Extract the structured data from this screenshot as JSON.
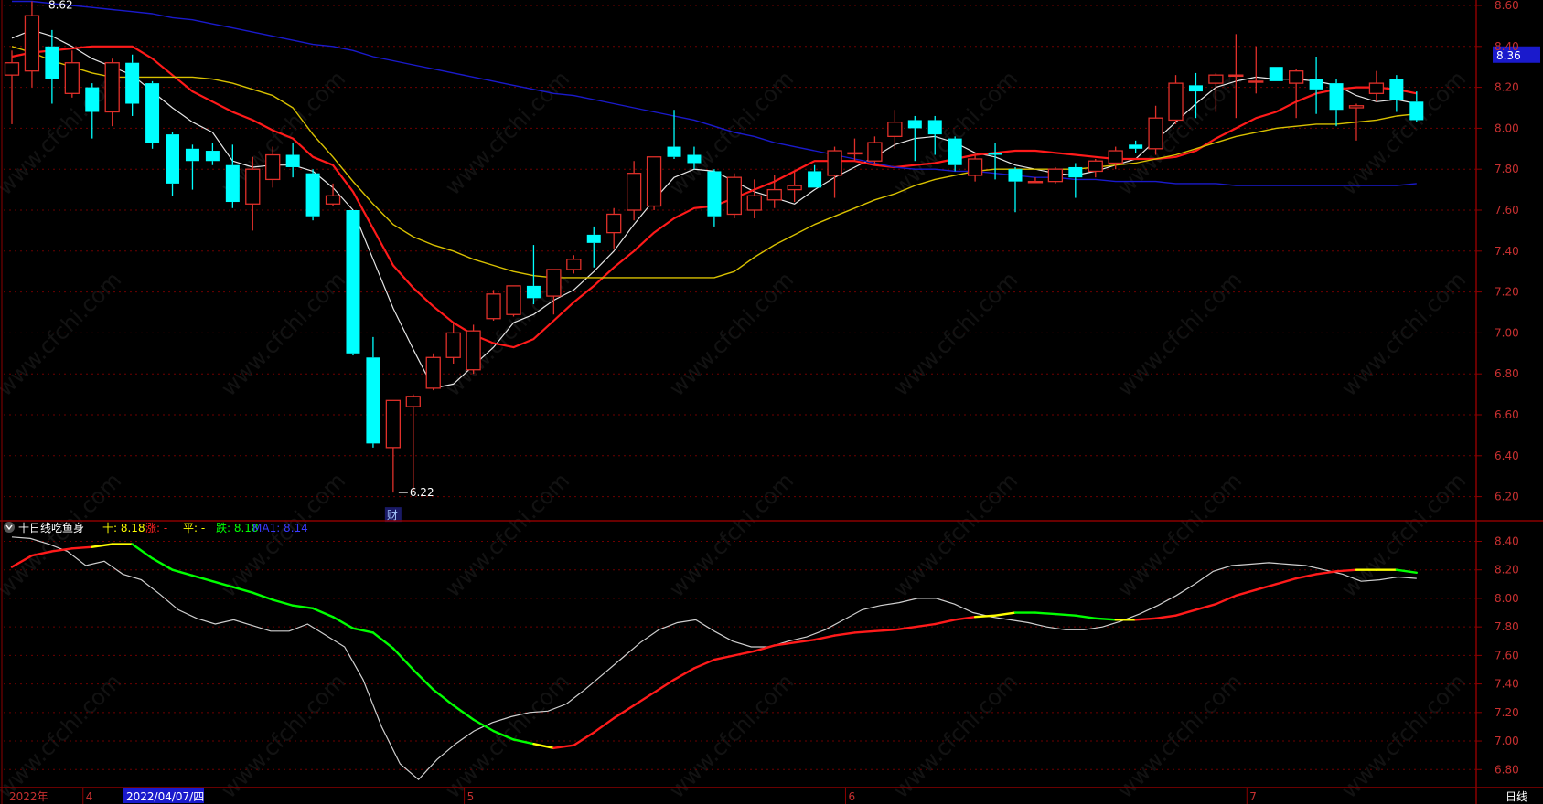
{
  "colors": {
    "background": "#000000",
    "axis": "#8b0000",
    "grid": "#6e0000",
    "up_candle": "#e0302a",
    "down_candle": "#00ffff",
    "ma_white": "#e6e6e6",
    "ma_red": "#ff1a1a",
    "ma_yellow": "#d8c000",
    "ma_blue": "#1a1acc",
    "indicator_up": "#ff1a1a",
    "indicator_flat": "#ffff00",
    "indicator_down": "#00ff00",
    "indicator_ma": "#cfcfcf",
    "tick_label": "#c83030",
    "current_price_bg": "#1a1acc"
  },
  "watermark": "www.cfchi.com",
  "annotations": {
    "high_label": "8.62",
    "low_label": "6.22",
    "finance_marker": "财",
    "current_price_tag": "8.36"
  },
  "indicator_legend": {
    "icon": "chevron-down-icon",
    "name": "十日线吃鱼身",
    "shi_label": "十: 8.18",
    "zhang_label": "涨: -",
    "ping_label": "平: -",
    "die_label": "跌: 8.18",
    "ma1_label": "MA1: 8.14"
  },
  "bottom_bar": {
    "year_label": "2022年",
    "month_labels": [
      {
        "text": "4",
        "idx": 4
      },
      {
        "text": "5",
        "idx": 23
      },
      {
        "text": "6",
        "idx": 42
      },
      {
        "text": "7",
        "idx": 62
      }
    ],
    "cursor_date": "2022/04/07/四",
    "period_label": "日线"
  },
  "chart_data": [
    {
      "type": "candlestick",
      "title": "",
      "ylim": [
        6.1,
        8.6
      ],
      "y_ticks": [
        6.2,
        6.4,
        6.6,
        6.8,
        7.0,
        7.2,
        7.4,
        7.6,
        7.8,
        8.0,
        8.2,
        8.4,
        8.6
      ],
      "grid": true,
      "candles": [
        {
          "o": 8.26,
          "h": 8.38,
          "l": 8.02,
          "c": 8.32
        },
        {
          "o": 8.28,
          "h": 8.62,
          "l": 8.2,
          "c": 8.55
        },
        {
          "o": 8.4,
          "h": 8.48,
          "l": 8.12,
          "c": 8.24
        },
        {
          "o": 8.17,
          "h": 8.38,
          "l": 8.15,
          "c": 8.32
        },
        {
          "o": 8.2,
          "h": 8.22,
          "l": 7.95,
          "c": 8.08
        },
        {
          "o": 8.08,
          "h": 8.34,
          "l": 8.01,
          "c": 8.32
        },
        {
          "o": 8.32,
          "h": 8.36,
          "l": 8.06,
          "c": 8.12
        },
        {
          "o": 8.22,
          "h": 8.23,
          "l": 7.9,
          "c": 7.93
        },
        {
          "o": 7.97,
          "h": 7.98,
          "l": 7.67,
          "c": 7.73
        },
        {
          "o": 7.9,
          "h": 7.92,
          "l": 7.7,
          "c": 7.84
        },
        {
          "o": 7.89,
          "h": 7.93,
          "l": 7.82,
          "c": 7.84
        },
        {
          "o": 7.82,
          "h": 7.92,
          "l": 7.61,
          "c": 7.64
        },
        {
          "o": 7.63,
          "h": 7.86,
          "l": 7.5,
          "c": 7.8
        },
        {
          "o": 7.75,
          "h": 7.91,
          "l": 7.71,
          "c": 7.87
        },
        {
          "o": 7.87,
          "h": 7.93,
          "l": 7.76,
          "c": 7.81
        },
        {
          "o": 7.78,
          "h": 7.8,
          "l": 7.55,
          "c": 7.57
        },
        {
          "o": 7.63,
          "h": 7.73,
          "l": 7.62,
          "c": 7.67
        },
        {
          "o": 7.6,
          "h": 7.6,
          "l": 6.89,
          "c": 6.9
        },
        {
          "o": 6.88,
          "h": 6.98,
          "l": 6.44,
          "c": 6.46
        },
        {
          "o": 6.44,
          "h": 6.67,
          "l": 6.22,
          "c": 6.67
        },
        {
          "o": 6.64,
          "h": 6.7,
          "l": 6.22,
          "c": 6.69
        },
        {
          "o": 6.73,
          "h": 6.9,
          "l": 6.72,
          "c": 6.88
        },
        {
          "o": 6.88,
          "h": 7.05,
          "l": 6.85,
          "c": 7.0
        },
        {
          "o": 6.82,
          "h": 7.04,
          "l": 6.8,
          "c": 7.01
        },
        {
          "o": 7.07,
          "h": 7.21,
          "l": 7.06,
          "c": 7.19
        },
        {
          "o": 7.09,
          "h": 7.23,
          "l": 7.08,
          "c": 7.23
        },
        {
          "o": 7.23,
          "h": 7.43,
          "l": 7.14,
          "c": 7.17
        },
        {
          "o": 7.18,
          "h": 7.31,
          "l": 7.09,
          "c": 7.31
        },
        {
          "o": 7.31,
          "h": 7.38,
          "l": 7.29,
          "c": 7.36
        },
        {
          "o": 7.48,
          "h": 7.52,
          "l": 7.32,
          "c": 7.44
        },
        {
          "o": 7.49,
          "h": 7.61,
          "l": 7.41,
          "c": 7.58
        },
        {
          "o": 7.6,
          "h": 7.84,
          "l": 7.55,
          "c": 7.78
        },
        {
          "o": 7.62,
          "h": 7.86,
          "l": 7.6,
          "c": 7.86
        },
        {
          "o": 7.91,
          "h": 8.09,
          "l": 7.85,
          "c": 7.86
        },
        {
          "o": 7.87,
          "h": 7.91,
          "l": 7.8,
          "c": 7.83
        },
        {
          "o": 7.79,
          "h": 7.8,
          "l": 7.52,
          "c": 7.57
        },
        {
          "o": 7.58,
          "h": 7.78,
          "l": 7.56,
          "c": 7.76
        },
        {
          "o": 7.6,
          "h": 7.75,
          "l": 7.56,
          "c": 7.67
        },
        {
          "o": 7.65,
          "h": 7.77,
          "l": 7.61,
          "c": 7.7
        },
        {
          "o": 7.7,
          "h": 7.79,
          "l": 7.64,
          "c": 7.72
        },
        {
          "o": 7.79,
          "h": 7.82,
          "l": 7.71,
          "c": 7.71
        },
        {
          "o": 7.77,
          "h": 7.91,
          "l": 7.66,
          "c": 7.89
        },
        {
          "o": 7.88,
          "h": 7.95,
          "l": 7.84,
          "c": 7.88
        },
        {
          "o": 7.84,
          "h": 7.96,
          "l": 7.82,
          "c": 7.93
        },
        {
          "o": 7.96,
          "h": 8.09,
          "l": 7.9,
          "c": 8.03
        },
        {
          "o": 8.04,
          "h": 8.06,
          "l": 7.84,
          "c": 8.0
        },
        {
          "o": 8.04,
          "h": 8.06,
          "l": 7.87,
          "c": 7.97
        },
        {
          "o": 7.95,
          "h": 7.96,
          "l": 7.79,
          "c": 7.82
        },
        {
          "o": 7.77,
          "h": 7.88,
          "l": 7.74,
          "c": 7.85
        },
        {
          "o": 7.88,
          "h": 7.93,
          "l": 7.75,
          "c": 7.87
        },
        {
          "o": 7.8,
          "h": 7.81,
          "l": 7.59,
          "c": 7.74
        },
        {
          "o": 7.74,
          "h": 7.76,
          "l": 7.74,
          "c": 7.74
        },
        {
          "o": 7.74,
          "h": 7.81,
          "l": 7.73,
          "c": 7.8
        },
        {
          "o": 7.81,
          "h": 7.83,
          "l": 7.66,
          "c": 7.76
        },
        {
          "o": 7.79,
          "h": 7.85,
          "l": 7.76,
          "c": 7.84
        },
        {
          "o": 7.83,
          "h": 7.91,
          "l": 7.8,
          "c": 7.89
        },
        {
          "o": 7.92,
          "h": 7.94,
          "l": 7.88,
          "c": 7.9
        },
        {
          "o": 7.9,
          "h": 8.11,
          "l": 7.87,
          "c": 8.05
        },
        {
          "o": 8.04,
          "h": 8.26,
          "l": 8.02,
          "c": 8.22
        },
        {
          "o": 8.21,
          "h": 8.27,
          "l": 8.05,
          "c": 8.18
        },
        {
          "o": 8.22,
          "h": 8.27,
          "l": 8.08,
          "c": 8.26
        },
        {
          "o": 8.26,
          "h": 8.46,
          "l": 8.05,
          "c": 8.26
        },
        {
          "o": 8.23,
          "h": 8.4,
          "l": 8.17,
          "c": 8.23
        },
        {
          "o": 8.3,
          "h": 8.3,
          "l": 8.23,
          "c": 8.23
        },
        {
          "o": 8.22,
          "h": 8.29,
          "l": 8.05,
          "c": 8.28
        },
        {
          "o": 8.24,
          "h": 8.35,
          "l": 8.07,
          "c": 8.19
        },
        {
          "o": 8.22,
          "h": 8.24,
          "l": 8.01,
          "c": 8.09
        },
        {
          "o": 8.1,
          "h": 8.12,
          "l": 7.94,
          "c": 8.11
        },
        {
          "o": 8.17,
          "h": 8.28,
          "l": 8.13,
          "c": 8.22
        },
        {
          "o": 8.24,
          "h": 8.26,
          "l": 8.08,
          "c": 8.14
        },
        {
          "o": 8.13,
          "h": 8.18,
          "l": 8.03,
          "c": 8.04
        }
      ],
      "series": [
        {
          "key": "white",
          "values": [
            8.44,
            8.48,
            8.45,
            8.4,
            8.34,
            8.3,
            8.26,
            8.18,
            8.1,
            8.03,
            7.98,
            7.84,
            7.81,
            7.82,
            7.82,
            7.79,
            7.71,
            7.6,
            7.36,
            7.12,
            6.92,
            6.73,
            6.75,
            6.84,
            6.93,
            7.05,
            7.09,
            7.16,
            7.21,
            7.3,
            7.4,
            7.53,
            7.65,
            7.76,
            7.8,
            7.79,
            7.74,
            7.69,
            7.66,
            7.63,
            7.7,
            7.76,
            7.81,
            7.86,
            7.92,
            7.95,
            7.96,
            7.93,
            7.88,
            7.86,
            7.82,
            7.8,
            7.78,
            7.77,
            7.79,
            7.82,
            7.85,
            7.94,
            8.03,
            8.12,
            8.2,
            8.23,
            8.25,
            8.24,
            8.24,
            8.23,
            8.21,
            8.16,
            8.13,
            8.14,
            8.12
          ]
        },
        {
          "key": "red",
          "values": [
            8.35,
            8.37,
            8.38,
            8.39,
            8.4,
            8.4,
            8.4,
            8.34,
            8.26,
            8.18,
            8.13,
            8.08,
            8.04,
            7.99,
            7.95,
            7.86,
            7.82,
            7.69,
            7.51,
            7.33,
            7.22,
            7.13,
            7.05,
            6.99,
            6.95,
            6.93,
            6.97,
            7.06,
            7.15,
            7.23,
            7.32,
            7.4,
            7.49,
            7.56,
            7.61,
            7.62,
            7.66,
            7.7,
            7.74,
            7.79,
            7.84,
            7.84,
            7.84,
            7.82,
            7.81,
            7.82,
            7.83,
            7.85,
            7.87,
            7.88,
            7.89,
            7.89,
            7.88,
            7.87,
            7.86,
            7.85,
            7.85,
            7.85,
            7.86,
            7.89,
            7.95,
            8.0,
            8.05,
            8.08,
            8.13,
            8.17,
            8.19,
            8.2,
            8.2,
            8.19,
            8.17
          ]
        },
        {
          "key": "yellow",
          "values": [
            8.4,
            8.37,
            8.33,
            8.3,
            8.27,
            8.25,
            8.25,
            8.25,
            8.25,
            8.25,
            8.24,
            8.22,
            8.19,
            8.16,
            8.1,
            7.97,
            7.86,
            7.74,
            7.63,
            7.53,
            7.47,
            7.43,
            7.4,
            7.36,
            7.33,
            7.3,
            7.28,
            7.27,
            7.27,
            7.27,
            7.27,
            7.27,
            7.27,
            7.27,
            7.27,
            7.27,
            7.3,
            7.37,
            7.43,
            7.48,
            7.53,
            7.57,
            7.61,
            7.65,
            7.68,
            7.72,
            7.75,
            7.77,
            7.79,
            7.8,
            7.8,
            7.8,
            7.8,
            7.8,
            7.81,
            7.82,
            7.83,
            7.85,
            7.87,
            7.9,
            7.93,
            7.96,
            7.98,
            8.0,
            8.01,
            8.02,
            8.02,
            8.03,
            8.04,
            8.06,
            8.07
          ]
        },
        {
          "key": "blue",
          "values": [
            8.62,
            8.62,
            8.61,
            8.6,
            8.59,
            8.58,
            8.57,
            8.56,
            8.54,
            8.53,
            8.51,
            8.49,
            8.47,
            8.45,
            8.43,
            8.41,
            8.4,
            8.38,
            8.35,
            8.33,
            8.31,
            8.29,
            8.27,
            8.25,
            8.23,
            8.21,
            8.19,
            8.17,
            8.16,
            8.14,
            8.12,
            8.1,
            8.08,
            8.06,
            8.04,
            8.01,
            7.98,
            7.96,
            7.93,
            7.91,
            7.89,
            7.87,
            7.85,
            7.83,
            7.81,
            7.8,
            7.8,
            7.79,
            7.79,
            7.78,
            7.77,
            7.76,
            7.76,
            7.75,
            7.75,
            7.74,
            7.74,
            7.74,
            7.73,
            7.73,
            7.73,
            7.72,
            7.72,
            7.72,
            7.72,
            7.72,
            7.72,
            7.72,
            7.72,
            7.72,
            7.73
          ]
        }
      ]
    },
    {
      "type": "line",
      "title": "十日线吃鱼身",
      "ylim": [
        6.68,
        8.48
      ],
      "y_ticks": [
        6.8,
        7.0,
        7.2,
        7.4,
        7.6,
        7.8,
        8.0,
        8.2,
        8.4
      ],
      "grid": true,
      "series": [
        {
          "name": "十",
          "values": [
            8.22,
            8.3,
            8.33,
            8.35,
            8.36,
            8.38,
            8.38,
            8.28,
            8.2,
            8.16,
            8.12,
            8.08,
            8.04,
            7.99,
            7.95,
            7.93,
            7.87,
            7.79,
            7.76,
            7.65,
            7.5,
            7.36,
            7.25,
            7.15,
            7.07,
            7.01,
            6.98,
            6.95,
            6.97,
            7.06,
            7.16,
            7.25,
            7.34,
            7.43,
            7.51,
            7.57,
            7.6,
            7.63,
            7.67,
            7.69,
            7.71,
            7.74,
            7.76,
            7.77,
            7.78,
            7.8,
            7.82,
            7.85,
            7.87,
            7.88,
            7.9,
            7.9,
            7.89,
            7.88,
            7.86,
            7.85,
            7.85,
            7.86,
            7.88,
            7.92,
            7.96,
            8.02,
            8.06,
            8.1,
            8.14,
            8.17,
            8.19,
            8.2,
            8.2,
            8.2,
            8.18
          ],
          "trend": [
            "up",
            "up",
            "up",
            "up",
            "up",
            "flat",
            "flat",
            "down",
            "down",
            "down",
            "down",
            "down",
            "down",
            "down",
            "down",
            "down",
            "down",
            "down",
            "down",
            "down",
            "down",
            "down",
            "down",
            "down",
            "down",
            "down",
            "down",
            "flat",
            "up",
            "up",
            "up",
            "up",
            "up",
            "up",
            "up",
            "up",
            "up",
            "up",
            "up",
            "up",
            "up",
            "up",
            "up",
            "up",
            "up",
            "up",
            "up",
            "up",
            "up",
            "flat",
            "flat",
            "down",
            "down",
            "down",
            "down",
            "down",
            "flat",
            "up",
            "up",
            "up",
            "up",
            "up",
            "up",
            "up",
            "up",
            "up",
            "up",
            "up",
            "flat",
            "flat",
            "down"
          ]
        },
        {
          "name": "MA1",
          "values": [
            8.43,
            8.42,
            8.38,
            8.33,
            8.23,
            8.26,
            8.17,
            8.13,
            8.03,
            7.92,
            7.86,
            7.82,
            7.85,
            7.81,
            7.77,
            7.77,
            7.82,
            7.74,
            7.66,
            7.43,
            7.1,
            6.84,
            6.73,
            6.87,
            6.98,
            7.07,
            7.13,
            7.17,
            7.2,
            7.21,
            7.26,
            7.36,
            7.47,
            7.58,
            7.69,
            7.78,
            7.83,
            7.85,
            7.77,
            7.7,
            7.66,
            7.66,
            7.7,
            7.73,
            7.78,
            7.85,
            7.92,
            7.95,
            7.97,
            8.0,
            8.0,
            7.96,
            7.9,
            7.87,
            7.85,
            7.83,
            7.8,
            7.78,
            7.78,
            7.8,
            7.84,
            7.89,
            7.95,
            8.02,
            8.1,
            8.19,
            8.23,
            8.24,
            8.25,
            8.24,
            8.23,
            8.2,
            8.17,
            8.12,
            8.13,
            8.15,
            8.14
          ]
        }
      ]
    }
  ]
}
